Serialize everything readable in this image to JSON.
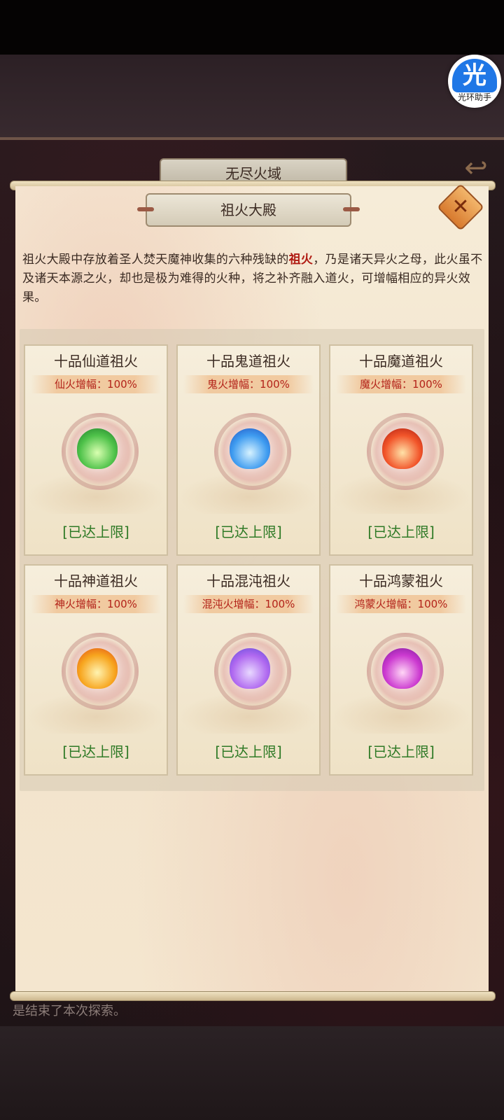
{
  "header": {
    "area_title": "无尽火域",
    "panel_title": "祖火大殿"
  },
  "assistant": {
    "glyph": "光",
    "label": "光环助手"
  },
  "description": {
    "before": "祖火大殿中存放着圣人焚天魔神收集的六种残缺的",
    "highlight": "祖火",
    "after": "，乃是诸天异火之母，此火虽不及诸天本源之火，却也是极为难得的火种，将之补齐融入道火，可增幅相应的异火效果。"
  },
  "fires": [
    {
      "name": "十品仙道祖火",
      "bonus": "仙火增幅：100%",
      "status": "[已达上限]",
      "color": "#4fc24a"
    },
    {
      "name": "十品鬼道祖火",
      "bonus": "鬼火增幅：100%",
      "status": "[已达上限]",
      "color": "#3f9cf0"
    },
    {
      "name": "十品魔道祖火",
      "bonus": "魔火增幅：100%",
      "status": "[已达上限]",
      "color": "#f2552a"
    },
    {
      "name": "十品神道祖火",
      "bonus": "神火增幅：100%",
      "status": "[已达上限]",
      "color": "#f7a51e"
    },
    {
      "name": "十品混沌祖火",
      "bonus": "混沌火增幅：100%",
      "status": "[已达上限]",
      "color": "#b069f0"
    },
    {
      "name": "十品鸿蒙祖火",
      "bonus": "鸿蒙火增幅：100%",
      "status": "[已达上限]",
      "color": "#cc3ad0"
    }
  ],
  "footer": {
    "log_text": "是结束了本次探索。"
  }
}
